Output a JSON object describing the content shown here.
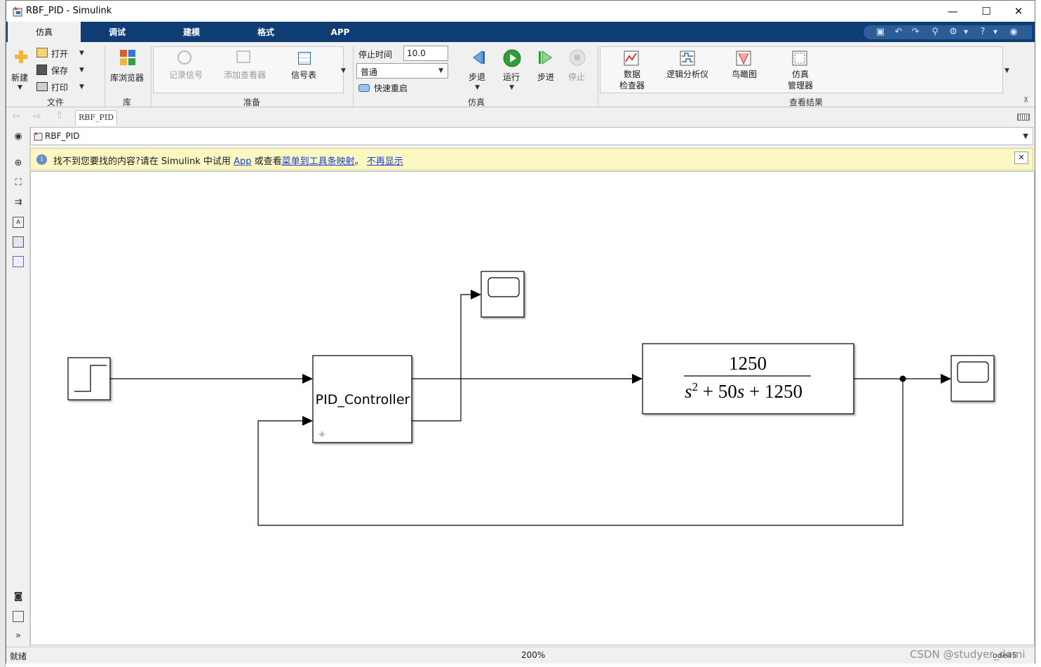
{
  "window": {
    "title": "RBF_PID - Simulink",
    "minimize": "—",
    "maximize": "☐",
    "close": "✕"
  },
  "tabs": [
    {
      "label": "仿真",
      "active": true
    },
    {
      "label": "调试",
      "active": false
    },
    {
      "label": "建模",
      "active": false
    },
    {
      "label": "格式",
      "active": false
    },
    {
      "label": "APP",
      "active": false
    }
  ],
  "ribbon": {
    "file": {
      "new": "新建",
      "open": "打开",
      "save": "保存",
      "print": "打印",
      "group": "文件"
    },
    "library": {
      "browser": "库浏览器",
      "group": "库"
    },
    "prepare": {
      "log_signals": "记录信号",
      "add_viewer": "添加查看器",
      "signal_table": "信号表",
      "group": "准备"
    },
    "simulate": {
      "stop_time_label": "停止时间",
      "stop_time_value": "10.0",
      "mode": "普通",
      "fast_restart": "快速重启",
      "step_back": "步退",
      "run": "运行",
      "step_forward": "步进",
      "stop": "停止",
      "group": "仿真"
    },
    "review": {
      "data_inspector": "数据",
      "data_inspector_2": "检查器",
      "logic_analyzer": "逻辑分析仪",
      "birds_eye": "鸟瞰图",
      "sim_manager": "仿真",
      "sim_manager_2": "管理器",
      "group": "查看结果"
    }
  },
  "explorer": {
    "tab": "RBF_PID",
    "address": "RBF_PID"
  },
  "banner": {
    "prefix": "找不到您要找的内容?请在 Simulink 中试用 ",
    "app_link": "App",
    "middle": " 或查看",
    "map_link": "菜单到工具条映射",
    "sep": "。",
    "dismiss_link": "不再显示"
  },
  "model": {
    "pid_block": "PID_Controller",
    "tf_numerator": "1250"
  },
  "status": {
    "left": "就绪",
    "zoom": "200%",
    "solver": "ode45",
    "watermark": "CSDN @studyer_domi"
  },
  "colors": {
    "tab_bar": "#0f3d73",
    "banner": "#fbf8c4",
    "run_green": "#2e9e3a"
  }
}
